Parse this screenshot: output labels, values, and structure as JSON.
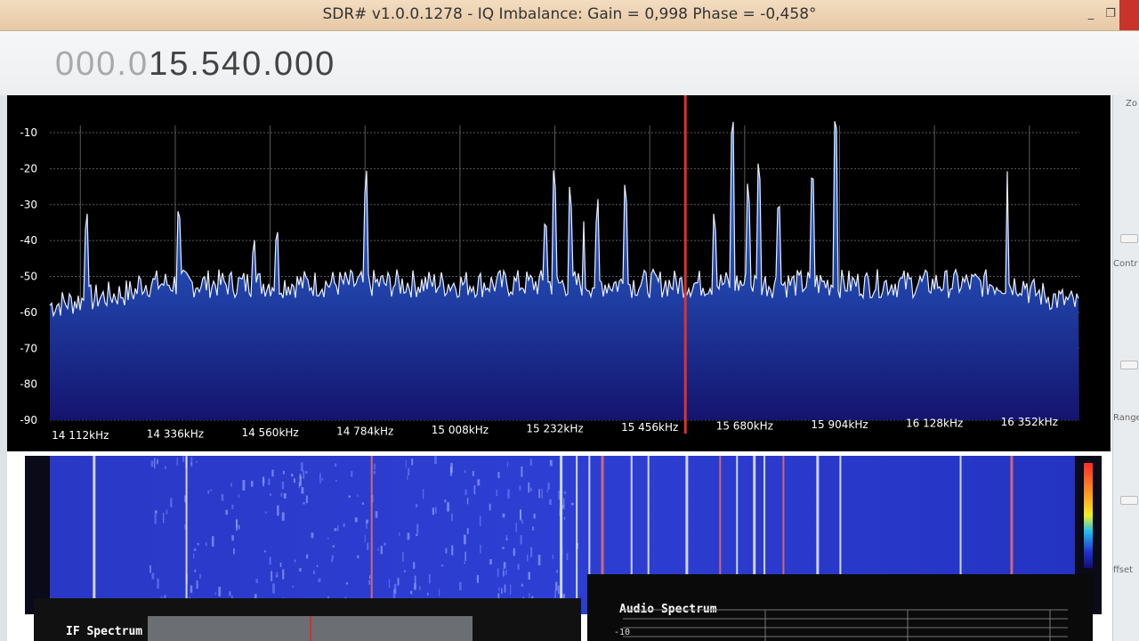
{
  "window": {
    "title": "SDR# v1.0.0.1278 - IQ Imbalance: Gain = 0,998 Phase = -0,458°",
    "minimize_icon": "minimize-icon",
    "maximize_icon": "maximize-icon",
    "close_icon": "close-icon"
  },
  "frequency": {
    "dim_part": "000.0",
    "active_part": "15.540.000"
  },
  "spectrum": {
    "y_ticks": [
      "-10",
      "-20",
      "-30",
      "-40",
      "-50",
      "-60",
      "-70",
      "-80",
      "-90"
    ],
    "x_ticks": [
      "14 112kHz",
      "14 336kHz",
      "14 560kHz",
      "14 784kHz",
      "15 008kHz",
      "15 232kHz",
      "15 456kHz",
      "15 680kHz",
      "15 904kHz",
      "16 128kHz",
      "16 352kHz"
    ],
    "noise_floor_db": -52,
    "peaks_khz_db": [
      [
        14125,
        -39
      ],
      [
        14345,
        -37
      ],
      [
        14520,
        -46
      ],
      [
        14575,
        -43
      ],
      [
        14784,
        -28
      ],
      [
        15210,
        -40
      ],
      [
        15232,
        -27
      ],
      [
        15270,
        -32
      ],
      [
        15300,
        -35
      ],
      [
        15330,
        -36
      ],
      [
        15400,
        -31
      ],
      [
        15610,
        -39
      ],
      [
        15650,
        -13
      ],
      [
        15690,
        -31
      ],
      [
        15715,
        -25
      ],
      [
        15760,
        -35
      ],
      [
        15840,
        -27
      ],
      [
        15895,
        -12
      ],
      [
        16300,
        -21
      ]
    ],
    "center_marker_khz": 15540,
    "colors": {
      "fill_top": "#2f7bf0",
      "fill_bottom": "#14146e",
      "trace": "#e8eefc",
      "marker": "#e03030",
      "grid": "#5a5a5a"
    }
  },
  "waterfall": {
    "signal_lines_khz": [
      14125,
      14345,
      14784,
      15232,
      15270,
      15300,
      15330,
      15400,
      15440,
      15530,
      15610,
      15650,
      15690,
      15715,
      15760,
      15840,
      15895,
      16180,
      16300
    ],
    "colors": {
      "background": "#2233c8",
      "line": "#dfe6ff",
      "line_red": "#e46a6a"
    }
  },
  "side": {
    "zoom_label": "Zo",
    "contrast_label": "Contr",
    "range_label": "Range",
    "offset_label": "Offset"
  },
  "if_spectrum": {
    "label": "IF Spectrum"
  },
  "audio_spectrum": {
    "label": "Audio Spectrum",
    "tick": "-10"
  }
}
